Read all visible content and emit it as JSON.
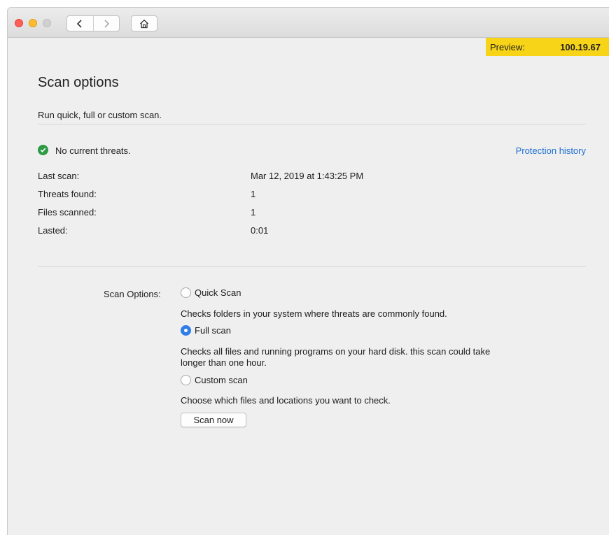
{
  "preview": {
    "label": "Preview:",
    "version": "100.19.67"
  },
  "page": {
    "title": "Scan options",
    "subtitle": "Run quick, full or custom scan."
  },
  "status": {
    "text": "No current threats.",
    "history_link": "Protection history"
  },
  "info": {
    "rows": [
      {
        "label": "Last scan:",
        "value": "Mar 12, 2019 at 1:43:25 PM"
      },
      {
        "label": "Threats found:",
        "value": "1"
      },
      {
        "label": "Files scanned:",
        "value": "1"
      },
      {
        "label": "Lasted:",
        "value": "0:01"
      }
    ]
  },
  "scan_options": {
    "label": "Scan Options:",
    "options": [
      {
        "label": "Quick Scan",
        "selected": false,
        "description": "Checks folders in your system where threats are commonly found."
      },
      {
        "label": "Full scan",
        "selected": true,
        "description": "Checks all files and running programs on your hard disk. this scan could take longer than one hour."
      },
      {
        "label": "Custom scan",
        "selected": false,
        "description": "Choose which files and locations you want to check."
      }
    ],
    "button_label": "Scan now"
  },
  "colors": {
    "accent": "#2f7de9",
    "link": "#1f6fd4",
    "success": "#2e9a44",
    "preview_bg": "#f7d417"
  },
  "icons": {
    "back": "chevron-left-icon",
    "forward": "chevron-right-icon",
    "home": "home-icon",
    "status": "check-circle-icon"
  }
}
